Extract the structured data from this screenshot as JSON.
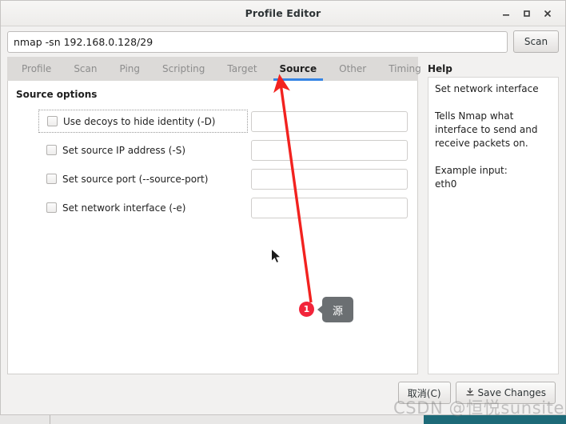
{
  "window": {
    "title": "Profile Editor",
    "controls": {
      "minimize": "minimize-icon",
      "maximize": "maximize-icon",
      "close": "close-icon"
    }
  },
  "command_bar": {
    "value": "nmap -sn 192.168.0.128/29",
    "placeholder": "",
    "scan_label": "Scan"
  },
  "tabs": [
    {
      "label": "Profile",
      "active": false
    },
    {
      "label": "Scan",
      "active": false
    },
    {
      "label": "Ping",
      "active": false
    },
    {
      "label": "Scripting",
      "active": false
    },
    {
      "label": "Target",
      "active": false
    },
    {
      "label": "Source",
      "active": true
    },
    {
      "label": "Other",
      "active": false
    },
    {
      "label": "Timing",
      "active": false
    }
  ],
  "source_panel": {
    "section_title": "Source options",
    "options": [
      {
        "label": "Use decoys to hide identity (-D)",
        "checked": false,
        "focused": true,
        "value": "",
        "placeholder": ""
      },
      {
        "label": "Set source IP address (-S)",
        "checked": false,
        "focused": false,
        "value": "",
        "placeholder": ""
      },
      {
        "label": "Set source port (--source-port)",
        "checked": false,
        "focused": false,
        "value": "",
        "placeholder": ""
      },
      {
        "label": "Set network interface (-e)",
        "checked": false,
        "focused": false,
        "value": "",
        "placeholder": ""
      }
    ]
  },
  "help": {
    "title": "Help",
    "text": "Set network interface\n\nTells Nmap what interface to send and receive packets on.\n\nExample input:\neth0"
  },
  "footer": {
    "cancel_label": "取消(C)",
    "save_label": "Save Changes"
  },
  "annotation": {
    "badge": "1",
    "callout": "源",
    "arrow_color": "#f2221f"
  },
  "watermark": {
    "text": "CSDN @恒悦sunsite"
  }
}
